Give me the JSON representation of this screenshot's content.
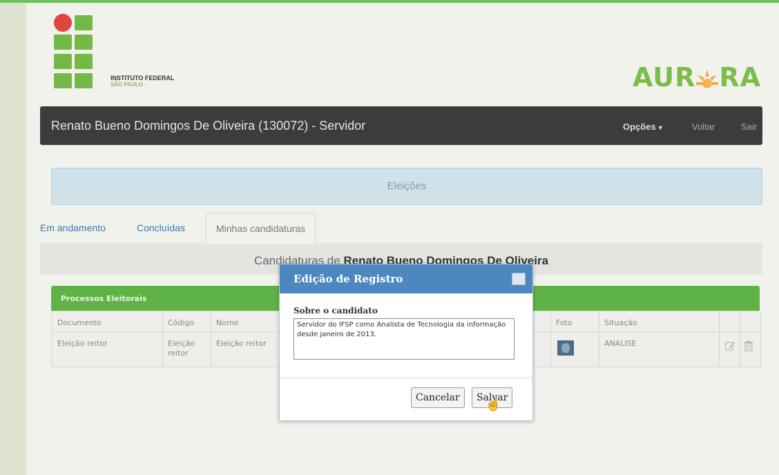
{
  "logo": {
    "line1": "INSTITUTO FEDERAL",
    "line2": "SÃO PAULO"
  },
  "brand": {
    "name": "AURORA",
    "accent": "#7bbd4a"
  },
  "navbar": {
    "title": "Renato Bueno Domingos De Oliveira (130072) - Servidor",
    "options": "Opções",
    "back": "Voltar",
    "exit": "Sair"
  },
  "panel": {
    "title": "Eleições"
  },
  "tabs": [
    {
      "label": "Em andamento"
    },
    {
      "label": "Concluídas"
    },
    {
      "label": "Minhas candidaturas"
    }
  ],
  "candidaturas": {
    "prefix": "Candidaturas de ",
    "name": "Renato Bueno Domingos De Oliveira"
  },
  "table": {
    "title": "Processos Eleitorais",
    "headers": {
      "documento": "Documento",
      "codigo": "Código",
      "nome": "Nome",
      "foto": "Foto",
      "situacao": "Situação"
    },
    "row": {
      "documento": "Eleição reitor",
      "codigo_1": "Eleição",
      "codigo_2": "reitor",
      "nome": "Eleição reitor",
      "situacao": "ANALISE"
    }
  },
  "modal": {
    "title": "Edição de Registro",
    "label": "Sobre o candidato",
    "text": "Servidor do IFSP como Analista de Tecnologia da informação desde janeiro de 2013.",
    "cancel": "Cancelar",
    "save": "Salvar"
  }
}
